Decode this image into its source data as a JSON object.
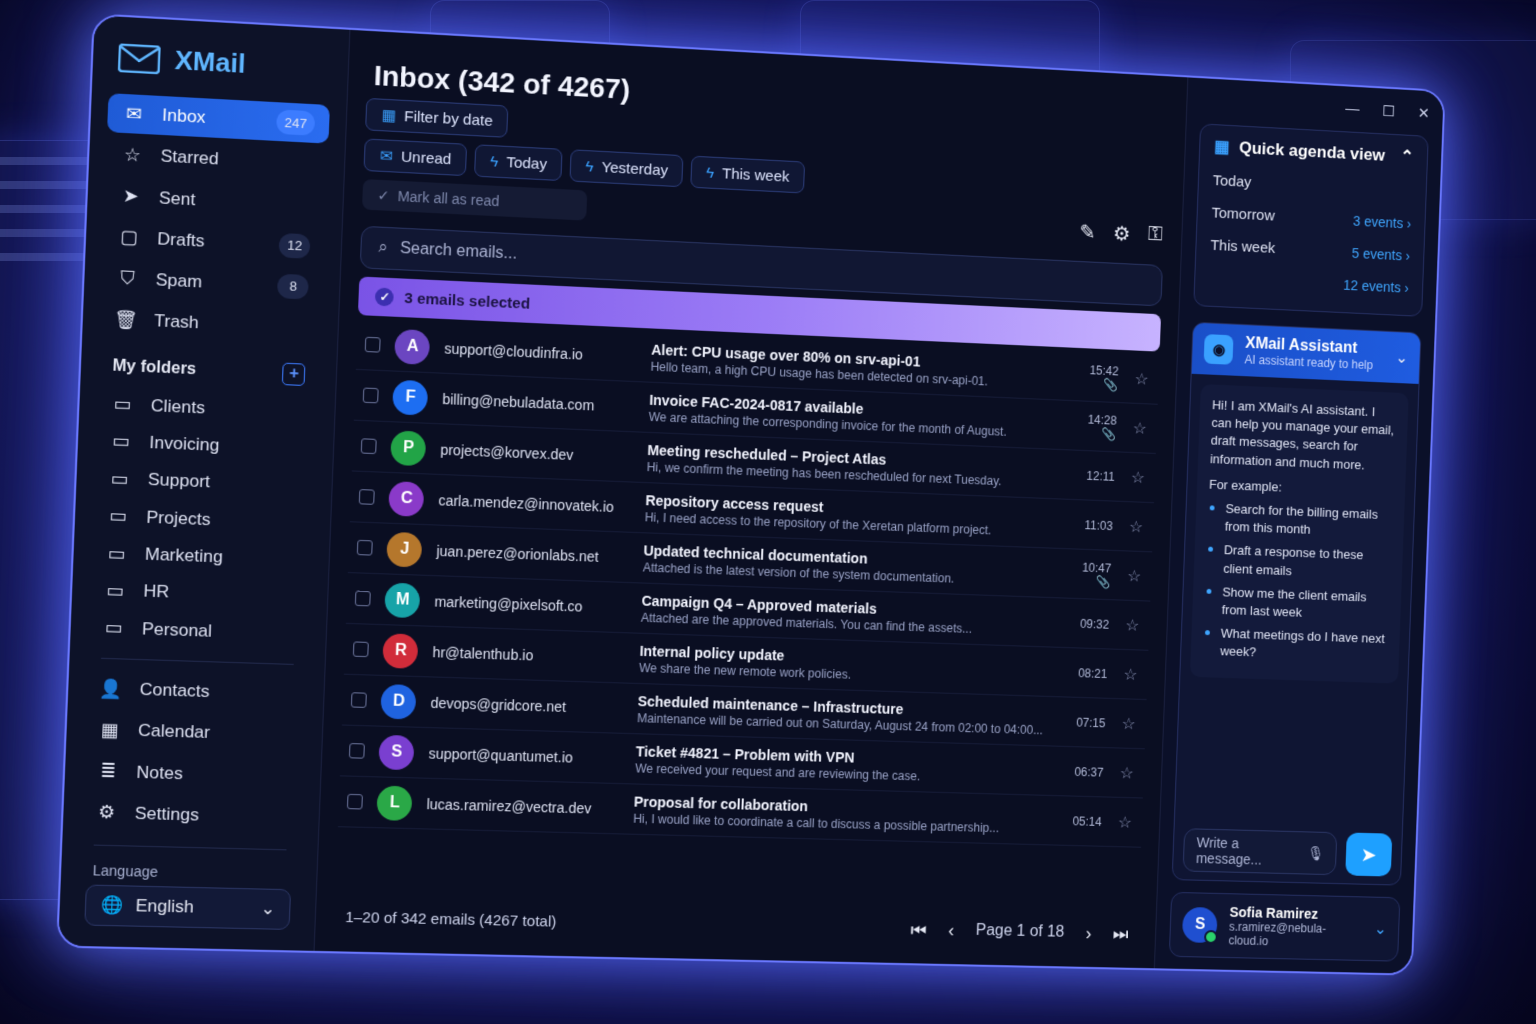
{
  "app": {
    "name": "XMail"
  },
  "sidebar": {
    "items": [
      {
        "label": "Inbox",
        "count": "247",
        "icon": "mail-icon"
      },
      {
        "label": "Starred",
        "count": "",
        "icon": "star-icon"
      },
      {
        "label": "Sent",
        "count": "",
        "icon": "send-icon"
      },
      {
        "label": "Drafts",
        "count": "12",
        "icon": "draft-icon"
      },
      {
        "label": "Spam",
        "count": "8",
        "icon": "shield-icon"
      },
      {
        "label": "Trash",
        "count": "",
        "icon": "trash-icon"
      }
    ],
    "folders_title": "My folders",
    "folders": [
      "Clients",
      "Invoicing",
      "Support",
      "Projects",
      "Marketing",
      "HR",
      "Personal"
    ],
    "bottom": [
      {
        "label": "Contacts",
        "icon": "contacts-icon"
      },
      {
        "label": "Calendar",
        "icon": "calendar-icon"
      },
      {
        "label": "Notes",
        "icon": "notes-icon"
      },
      {
        "label": "Settings",
        "icon": "gear-icon"
      }
    ],
    "language_label": "Language",
    "language_value": "English"
  },
  "main": {
    "title": "Inbox (342 of 4267)",
    "filter_by_date": "Filter by date",
    "chips": [
      "Unread",
      "Today",
      "Yesterday",
      "This week"
    ],
    "mark_all": "Mark all as read",
    "search_placeholder": "Search emails...",
    "selected_text": "3 emails selected",
    "emails": [
      {
        "initial": "A",
        "color": "#6b46c1",
        "from": "support@cloudinfra.io",
        "subject": "Alert: CPU usage over 80% on srv-api-01",
        "preview": "Hello team, a high CPU usage has been detected on srv-api-01.",
        "time": "15:42",
        "attachment": true
      },
      {
        "initial": "F",
        "color": "#1d6ef2",
        "from": "billing@nebuladata.com",
        "subject": "Invoice FAC-2024-0817 available",
        "preview": "We are attaching the corresponding invoice for the month of August.",
        "time": "14:28",
        "attachment": true
      },
      {
        "initial": "P",
        "color": "#22a447",
        "from": "projects@korvex.dev",
        "subject": "Meeting rescheduled – Project Atlas",
        "preview": "Hi, we confirm the meeting has been rescheduled for next Tuesday.",
        "time": "12:11",
        "attachment": false
      },
      {
        "initial": "C",
        "color": "#8a3ac9",
        "from": "carla.mendez@innovatek.io",
        "subject": "Repository access request",
        "preview": "Hi, I need access to the repository of the Xeretan platform project.",
        "time": "11:03",
        "attachment": false
      },
      {
        "initial": "J",
        "color": "#b5772c",
        "from": "juan.perez@orionlabs.net",
        "subject": "Updated technical documentation",
        "preview": "Attached is the latest version of the system documentation.",
        "time": "10:47",
        "attachment": true
      },
      {
        "initial": "M",
        "color": "#17a3a8",
        "from": "marketing@pixelsoft.co",
        "subject": "Campaign Q4 – Approved materials",
        "preview": "Attached are the approved materials. You can find the assets...",
        "time": "09:32",
        "attachment": false
      },
      {
        "initial": "R",
        "color": "#d12c3a",
        "from": "hr@talenthub.io",
        "subject": "Internal policy update",
        "preview": "We share the new remote work policies.",
        "time": "08:21",
        "attachment": false
      },
      {
        "initial": "D",
        "color": "#1f63e0",
        "from": "devops@gridcore.net",
        "subject": "Scheduled maintenance – Infrastructure",
        "preview": "Maintenance will be carried out on Saturday, August 24 from 02:00 to 04:00...",
        "time": "07:15",
        "attachment": false
      },
      {
        "initial": "S",
        "color": "#7a3fd0",
        "from": "support@quantumet.io",
        "subject": "Ticket #4821 – Problem with VPN",
        "preview": "We received your request and are reviewing the case.",
        "time": "06:37",
        "attachment": false
      },
      {
        "initial": "L",
        "color": "#2aa847",
        "from": "lucas.ramirez@vectra.dev",
        "subject": "Proposal for collaboration",
        "preview": "Hi, I would like to coordinate a call to discuss a possible partnership...",
        "time": "05:14",
        "attachment": false
      }
    ],
    "footer_range": "1–20 of 342 emails (4267 total)",
    "page": "Page 1 of 18"
  },
  "agenda": {
    "title": "Quick agenda view",
    "rows": [
      {
        "label": "Today",
        "events": ""
      },
      {
        "label": "Tomorrow",
        "events": "3 events"
      },
      {
        "label": "This week",
        "events": "5 events"
      },
      {
        "label": "",
        "events": "12 events"
      }
    ]
  },
  "assistant": {
    "title": "XMail Assistant",
    "subtitle": "AI assistant ready to help",
    "intro": "Hi! I am XMail's AI assistant. I can help you manage your email, draft messages, search for information and much more.",
    "example_label": "For example:",
    "examples": [
      "Search for the billing emails from this month",
      "Draft a response to these client emails",
      "Show me the client emails from last week",
      "What meetings do I have next week?"
    ],
    "input_placeholder": "Write a message..."
  },
  "user": {
    "initial": "S",
    "name": "Sofia Ramirez",
    "email": "s.ramirez@nebula-cloud.io"
  },
  "colors": {
    "accent": "#1f5ce0",
    "brand": "#5fb6ff",
    "selection": "#9b7cf6"
  }
}
